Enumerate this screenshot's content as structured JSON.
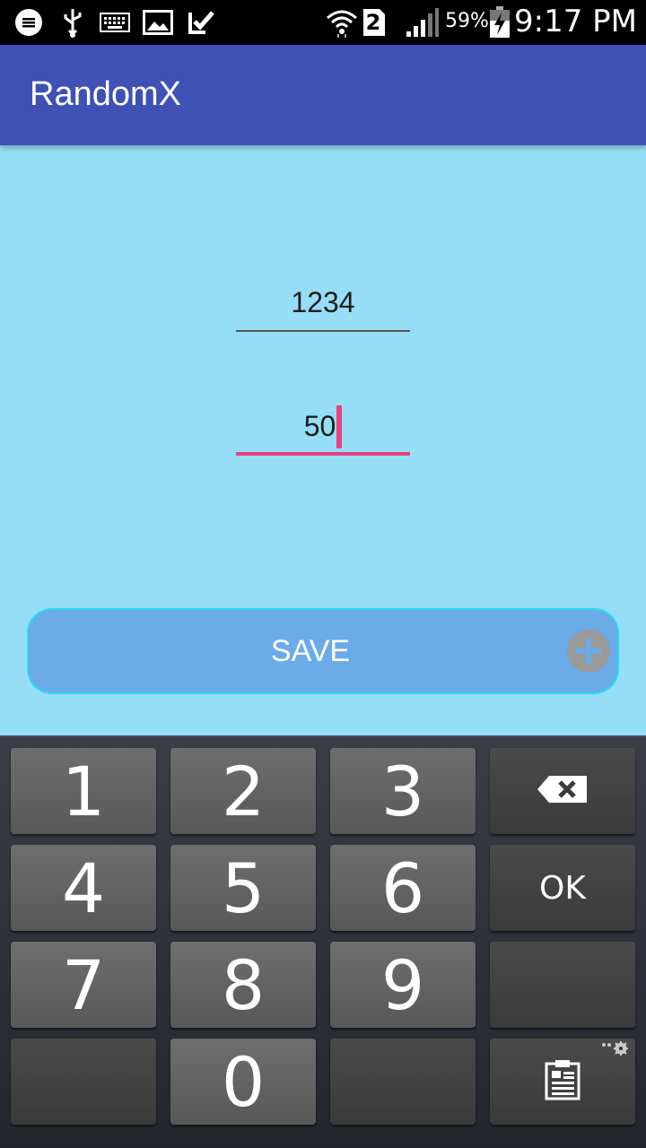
{
  "status_bar": {
    "time": "9:17 PM",
    "battery_percent": "59%",
    "sim_number": "2",
    "icons": [
      "chat-bubble-icon",
      "usb-icon",
      "keyboard-icon",
      "image-icon",
      "check-icon",
      "wifi-icon",
      "sim-icon",
      "signal-icon",
      "battery-charging-icon"
    ]
  },
  "app_bar": {
    "title": "RandomX"
  },
  "form": {
    "field_1": {
      "value": "1234"
    },
    "field_2": {
      "value": "50",
      "focused": true
    }
  },
  "save_button": {
    "label": "SAVE",
    "icon": "plus-circle-icon"
  },
  "keyboard": {
    "keys": [
      "1",
      "2",
      "3",
      "4",
      "5",
      "6",
      "7",
      "8",
      "9",
      "0"
    ],
    "ok_label": "OK",
    "icons": [
      "backspace-icon",
      "clipboard-icon",
      "settings-gear-icon"
    ]
  }
}
